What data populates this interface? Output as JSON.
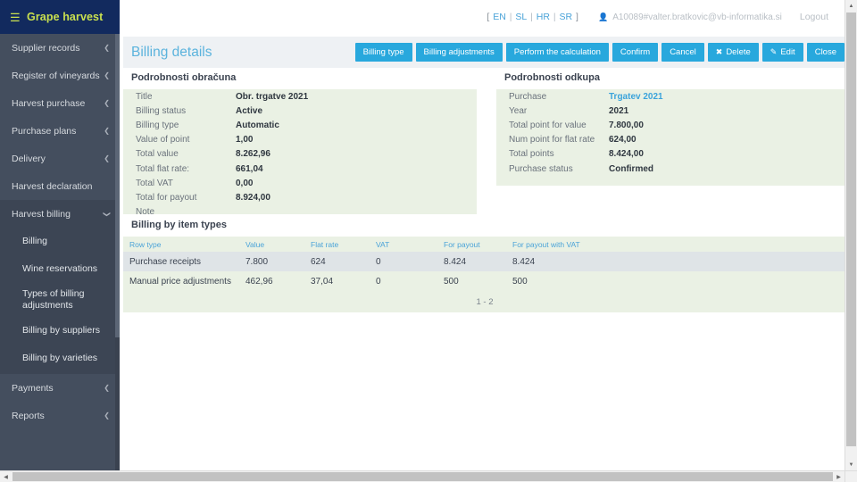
{
  "brand": {
    "menu_icon": "hamburger-icon",
    "title": "Grape harvest"
  },
  "topbar": {
    "languages": [
      "EN",
      "SL",
      "HR",
      "SR"
    ],
    "lang_open": "[",
    "lang_close": "]",
    "lang_sep": "|",
    "user_icon": "user-icon",
    "user": "A10089#valter.bratkovic@vb-informatika.si",
    "logout_label": "Logout"
  },
  "sidebar": {
    "items": [
      {
        "label": "Supplier records",
        "expandable": true,
        "open": false
      },
      {
        "label": "Register of vineyards",
        "expandable": true,
        "open": false
      },
      {
        "label": "Harvest purchase",
        "expandable": true,
        "open": false
      },
      {
        "label": "Purchase plans",
        "expandable": true,
        "open": false
      },
      {
        "label": "Delivery",
        "expandable": true,
        "open": false
      },
      {
        "label": "Harvest declaration",
        "expandable": false,
        "open": false
      },
      {
        "label": "Harvest billing",
        "expandable": true,
        "open": true
      }
    ],
    "submenu": [
      {
        "label": "Billing",
        "active": true
      },
      {
        "label": "Wine reservations",
        "active": false
      },
      {
        "label": "Types of billing adjustments",
        "active": false
      },
      {
        "label": "Billing by suppliers",
        "active": false
      },
      {
        "label": "Billing by varieties",
        "active": false
      }
    ],
    "items_after": [
      {
        "label": "Payments",
        "expandable": true
      },
      {
        "label": "Reports",
        "expandable": true
      }
    ]
  },
  "page": {
    "title": "Billing details"
  },
  "toolbar": {
    "buttons": [
      {
        "label": "Billing type",
        "icon": ""
      },
      {
        "label": "Billing adjustments",
        "icon": ""
      },
      {
        "label": "Perform the calculation",
        "icon": ""
      },
      {
        "label": "Confirm",
        "icon": ""
      },
      {
        "label": "Cancel",
        "icon": ""
      },
      {
        "label": "Delete",
        "icon": "✖"
      },
      {
        "label": "Edit",
        "icon": "✎"
      },
      {
        "label": "Close",
        "icon": ""
      }
    ]
  },
  "billing_details": {
    "title": "Podrobnosti obračuna",
    "rows": [
      {
        "key": "Title",
        "value": "Obr. trgatve 2021",
        "link": false
      },
      {
        "key": "Billing status",
        "value": "Active",
        "link": false
      },
      {
        "key": "Billing type",
        "value": "Automatic",
        "link": false
      },
      {
        "key": "Value of point",
        "value": "1,00",
        "link": false
      },
      {
        "key": "Total value",
        "value": "8.262,96",
        "link": false
      },
      {
        "key": "Total flat rate:",
        "value": "661,04",
        "link": false
      },
      {
        "key": "Total VAT",
        "value": "0,00",
        "link": false
      },
      {
        "key": "Total for payout",
        "value": "8.924,00",
        "link": false
      },
      {
        "key": "Note",
        "value": "",
        "link": false
      }
    ]
  },
  "purchase_details": {
    "title": "Podrobnosti odkupa",
    "rows": [
      {
        "key": "Purchase",
        "value": "Trgatev 2021",
        "link": true
      },
      {
        "key": "Year",
        "value": "2021",
        "link": false
      },
      {
        "key": "Total point for value",
        "value": "7.800,00",
        "link": false
      },
      {
        "key": "Num point for flat rate",
        "value": "624,00",
        "link": false
      },
      {
        "key": "Total points",
        "value": "8.424,00",
        "link": false
      },
      {
        "key": "Purchase status",
        "value": "Confirmed",
        "link": false
      }
    ]
  },
  "table": {
    "title": "Billing by item types",
    "columns": [
      "Row type",
      "Value",
      "Flat rate",
      "VAT",
      "For payout",
      "For payout with VAT"
    ],
    "rows": [
      [
        "Purchase receipts",
        "7.800",
        "624",
        "0",
        "8.424",
        "8.424"
      ],
      [
        "Manual price adjustments",
        "462,96",
        "37,04",
        "0",
        "500",
        "500"
      ]
    ],
    "pagination": "1 - 2"
  },
  "colors": {
    "brand_bar": "#122a5e",
    "brand_text": "#c9e04f",
    "sidebar": "#444e5e",
    "sidebar_open": "#3c4554",
    "accent": "#28a8dd",
    "page_title": "#5bb3dd",
    "panel_bg": "#eaf1e4",
    "header_bg": "#eef1f4",
    "row_odd": "#dfe4e7"
  }
}
